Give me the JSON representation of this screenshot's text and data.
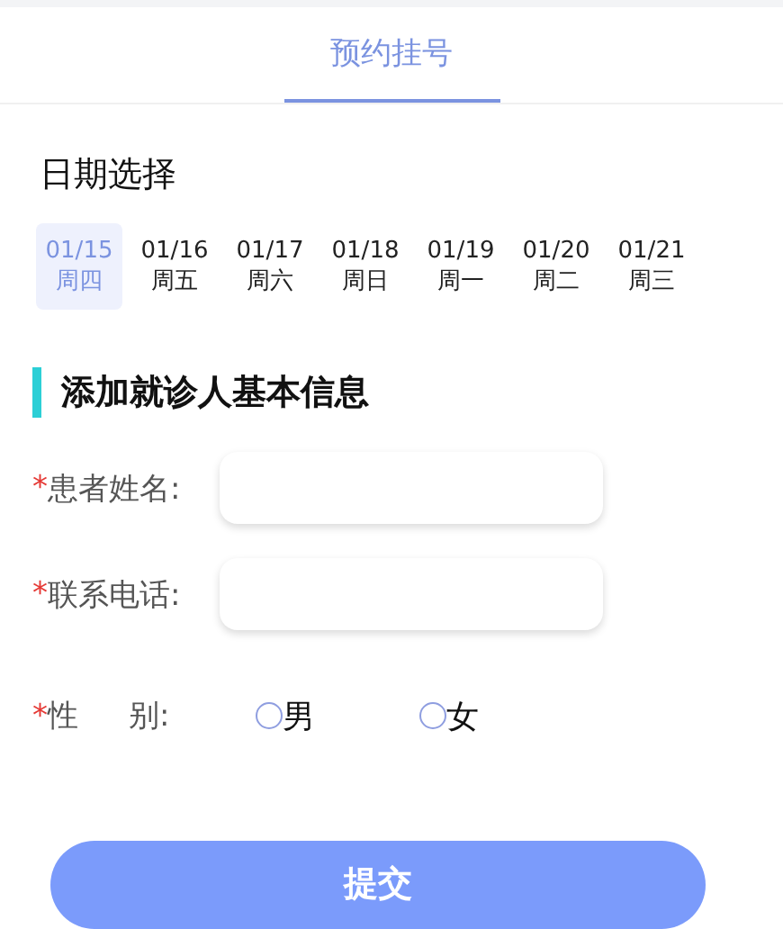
{
  "tabs": [
    {
      "label": "预约挂号",
      "selected": true
    }
  ],
  "date_section": {
    "title": "日期选择",
    "dates": [
      {
        "date": "01/15",
        "weekday": "周四",
        "selected": true
      },
      {
        "date": "01/16",
        "weekday": "周五",
        "selected": false
      },
      {
        "date": "01/17",
        "weekday": "周六",
        "selected": false
      },
      {
        "date": "01/18",
        "weekday": "周日",
        "selected": false
      },
      {
        "date": "01/19",
        "weekday": "周一",
        "selected": false
      },
      {
        "date": "01/20",
        "weekday": "周二",
        "selected": false
      },
      {
        "date": "01/21",
        "weekday": "周三",
        "selected": false
      }
    ]
  },
  "form": {
    "title": "添加就诊人基本信息",
    "fields": [
      {
        "kind": "text",
        "mark": "*",
        "label": "患者姓名:"
      },
      {
        "kind": "text",
        "mark": "*",
        "label": "联系电话:"
      },
      {
        "kind": "radio",
        "mark": "*",
        "label_parts": [
          "性",
          "别:"
        ],
        "options": [
          {
            "label": "男",
            "selected": false
          },
          {
            "label": "女",
            "selected": false
          }
        ]
      }
    ]
  },
  "submit": {
    "label": "提交"
  }
}
